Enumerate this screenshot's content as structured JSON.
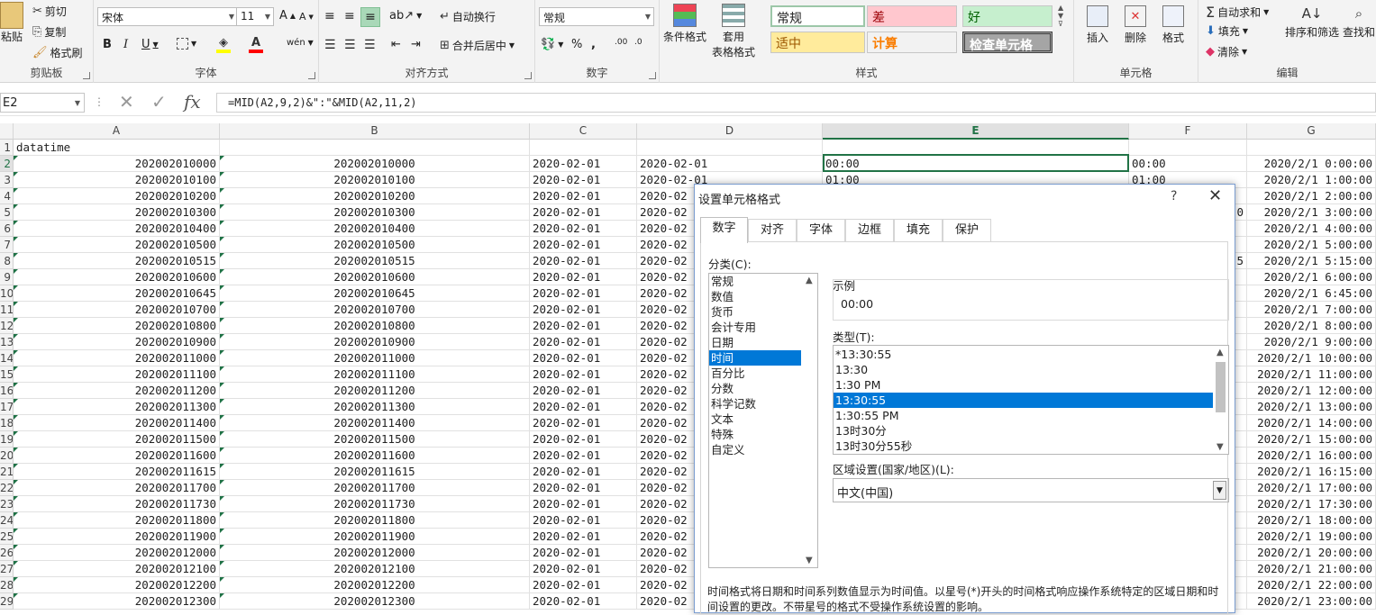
{
  "ribbon": {
    "clipboard": {
      "paste": "粘贴",
      "cut": "剪切",
      "copy": "复制",
      "format_painter": "格式刷",
      "label": "剪贴板"
    },
    "font": {
      "name": "宋体",
      "size": "11",
      "label": "字体"
    },
    "alignment": {
      "wrap": "自动换行",
      "merge": "合并后居中",
      "label": "对齐方式"
    },
    "number": {
      "format": "常规",
      "label": "数字"
    },
    "styles": {
      "conditional": "条件格式",
      "table_format": "套用\n表格格式",
      "table_format_l1": "套用",
      "table_format_l2": "表格格式",
      "cells": [
        "常规",
        "差",
        "好",
        "适中",
        "计算",
        "检查单元格"
      ],
      "label": "样式"
    },
    "cells": {
      "insert": "插入",
      "delete": "删除",
      "format": "格式",
      "label": "单元格"
    },
    "editing": {
      "autosum": "自动求和",
      "fill": "填充",
      "clear": "清除",
      "sort_filter": "排序和筛选",
      "find": "查找和",
      "label": "编辑"
    }
  },
  "formula_bar": {
    "name_box": "E2",
    "formula": "=MID(A2,9,2)&\":\"&MID(A2,11,2)"
  },
  "sheet": {
    "columns": [
      "A",
      "B",
      "C",
      "D",
      "E",
      "F",
      "G"
    ],
    "rows": [
      {
        "n": "1",
        "a": "datatime",
        "b": "",
        "c": "",
        "d": "",
        "e": "",
        "f": "",
        "g": ""
      },
      {
        "n": "2",
        "a": "202002010000",
        "b": "202002010000",
        "c": "2020-02-01",
        "d": "2020-02-01",
        "e": "00:00",
        "f": "00:00",
        "g": "2020/2/1  0:00:00"
      },
      {
        "n": "3",
        "a": "202002010100",
        "b": "202002010100",
        "c": "2020-02-01",
        "d": "2020-02-01",
        "e": "01:00",
        "f": "01:00",
        "g": "2020/2/1  1:00:00"
      },
      {
        "n": "4",
        "a": "202002010200",
        "b": "202002010200",
        "c": "2020-02-01",
        "d": "2020-02",
        "e": "",
        "f": "",
        "g": "2020/2/1  2:00:00"
      },
      {
        "n": "5",
        "a": "202002010300",
        "b": "202002010300",
        "c": "2020-02-01",
        "d": "2020-02",
        "e": "",
        "f": "0",
        "g": "2020/2/1  3:00:00"
      },
      {
        "n": "6",
        "a": "202002010400",
        "b": "202002010400",
        "c": "2020-02-01",
        "d": "2020-02",
        "e": "",
        "f": "",
        "g": "2020/2/1  4:00:00"
      },
      {
        "n": "7",
        "a": "202002010500",
        "b": "202002010500",
        "c": "2020-02-01",
        "d": "2020-02",
        "e": "",
        "f": "",
        "g": "2020/2/1  5:00:00"
      },
      {
        "n": "8",
        "a": "202002010515",
        "b": "202002010515",
        "c": "2020-02-01",
        "d": "2020-02",
        "e": "",
        "f": "5",
        "g": "2020/2/1  5:15:00"
      },
      {
        "n": "9",
        "a": "202002010600",
        "b": "202002010600",
        "c": "2020-02-01",
        "d": "2020-02",
        "e": "",
        "f": "",
        "g": "2020/2/1  6:00:00"
      },
      {
        "n": "10",
        "a": "202002010645",
        "b": "202002010645",
        "c": "2020-02-01",
        "d": "2020-02",
        "e": "",
        "f": "",
        "g": "2020/2/1  6:45:00"
      },
      {
        "n": "11",
        "a": "202002010700",
        "b": "202002010700",
        "c": "2020-02-01",
        "d": "2020-02",
        "e": "",
        "f": "",
        "g": "2020/2/1  7:00:00"
      },
      {
        "n": "12",
        "a": "202002010800",
        "b": "202002010800",
        "c": "2020-02-01",
        "d": "2020-02",
        "e": "",
        "f": "",
        "g": "2020/2/1  8:00:00"
      },
      {
        "n": "13",
        "a": "202002010900",
        "b": "202002010900",
        "c": "2020-02-01",
        "d": "2020-02",
        "e": "",
        "f": "",
        "g": "2020/2/1  9:00:00"
      },
      {
        "n": "14",
        "a": "202002011000",
        "b": "202002011000",
        "c": "2020-02-01",
        "d": "2020-02",
        "e": "",
        "f": "",
        "g": "2020/2/1  10:00:00"
      },
      {
        "n": "15",
        "a": "202002011100",
        "b": "202002011100",
        "c": "2020-02-01",
        "d": "2020-02",
        "e": "",
        "f": "",
        "g": "2020/2/1  11:00:00"
      },
      {
        "n": "16",
        "a": "202002011200",
        "b": "202002011200",
        "c": "2020-02-01",
        "d": "2020-02",
        "e": "",
        "f": "",
        "g": "2020/2/1  12:00:00"
      },
      {
        "n": "17",
        "a": "202002011300",
        "b": "202002011300",
        "c": "2020-02-01",
        "d": "2020-02",
        "e": "",
        "f": "",
        "g": "2020/2/1  13:00:00"
      },
      {
        "n": "18",
        "a": "202002011400",
        "b": "202002011400",
        "c": "2020-02-01",
        "d": "2020-02",
        "e": "",
        "f": "",
        "g": "2020/2/1  14:00:00"
      },
      {
        "n": "19",
        "a": "202002011500",
        "b": "202002011500",
        "c": "2020-02-01",
        "d": "2020-02",
        "e": "",
        "f": "",
        "g": "2020/2/1  15:00:00"
      },
      {
        "n": "20",
        "a": "202002011600",
        "b": "202002011600",
        "c": "2020-02-01",
        "d": "2020-02",
        "e": "",
        "f": "",
        "g": "2020/2/1  16:00:00"
      },
      {
        "n": "21",
        "a": "202002011615",
        "b": "202002011615",
        "c": "2020-02-01",
        "d": "2020-02",
        "e": "",
        "f": "",
        "g": "2020/2/1  16:15:00"
      },
      {
        "n": "22",
        "a": "202002011700",
        "b": "202002011700",
        "c": "2020-02-01",
        "d": "2020-02",
        "e": "",
        "f": "",
        "g": "2020/2/1  17:00:00"
      },
      {
        "n": "23",
        "a": "202002011730",
        "b": "202002011730",
        "c": "2020-02-01",
        "d": "2020-02",
        "e": "",
        "f": "",
        "g": "2020/2/1  17:30:00"
      },
      {
        "n": "24",
        "a": "202002011800",
        "b": "202002011800",
        "c": "2020-02-01",
        "d": "2020-02",
        "e": "",
        "f": "",
        "g": "2020/2/1  18:00:00"
      },
      {
        "n": "25",
        "a": "202002011900",
        "b": "202002011900",
        "c": "2020-02-01",
        "d": "2020-02",
        "e": "",
        "f": "",
        "g": "2020/2/1  19:00:00"
      },
      {
        "n": "26",
        "a": "202002012000",
        "b": "202002012000",
        "c": "2020-02-01",
        "d": "2020-02",
        "e": "",
        "f": "",
        "g": "2020/2/1  20:00:00"
      },
      {
        "n": "27",
        "a": "202002012100",
        "b": "202002012100",
        "c": "2020-02-01",
        "d": "2020-02",
        "e": "",
        "f": "",
        "g": "2020/2/1  21:00:00"
      },
      {
        "n": "28",
        "a": "202002012200",
        "b": "202002012200",
        "c": "2020-02-01",
        "d": "2020-02",
        "e": "",
        "f": "",
        "g": "2020/2/1  22:00:00"
      },
      {
        "n": "29",
        "a": "202002012300",
        "b": "202002012300",
        "c": "2020-02-01",
        "d": "2020-02",
        "e": "",
        "f": "",
        "g": "2020/2/1  23:00:00"
      }
    ]
  },
  "dialog": {
    "title": "设置单元格格式",
    "help": "?",
    "close": "✕",
    "tabs": [
      "数字",
      "对齐",
      "字体",
      "边框",
      "填充",
      "保护"
    ],
    "category_label": "分类(C):",
    "categories": [
      "常规",
      "数值",
      "货币",
      "会计专用",
      "日期",
      "时间",
      "百分比",
      "分数",
      "科学记数",
      "文本",
      "特殊",
      "自定义"
    ],
    "selected_category": "时间",
    "sample_label": "示例",
    "sample_value": "00:00",
    "type_label": "类型(T):",
    "types": [
      "*13:30:55",
      "13:30",
      "1:30 PM",
      "13:30:55",
      "1:30:55 PM",
      "13时30分",
      "13时30分55秒"
    ],
    "selected_type_index": 3,
    "locale_label": "区域设置(国家/地区)(L):",
    "locale_value": "中文(中国)",
    "description": "时间格式将日期和时间系列数值显示为时间值。以星号(*)开头的时间格式响应操作系统特定的区域日期和时间设置的更改。不带星号的格式不受操作系统设置的影响。"
  },
  "colors": {
    "excel_green": "#217346",
    "selection_blue": "#0078d7",
    "bad_fill": "#ffc7ce",
    "good_fill": "#c6efce",
    "neutral_fill": "#ffeb9c",
    "check_fill": "#a5a5a5"
  }
}
